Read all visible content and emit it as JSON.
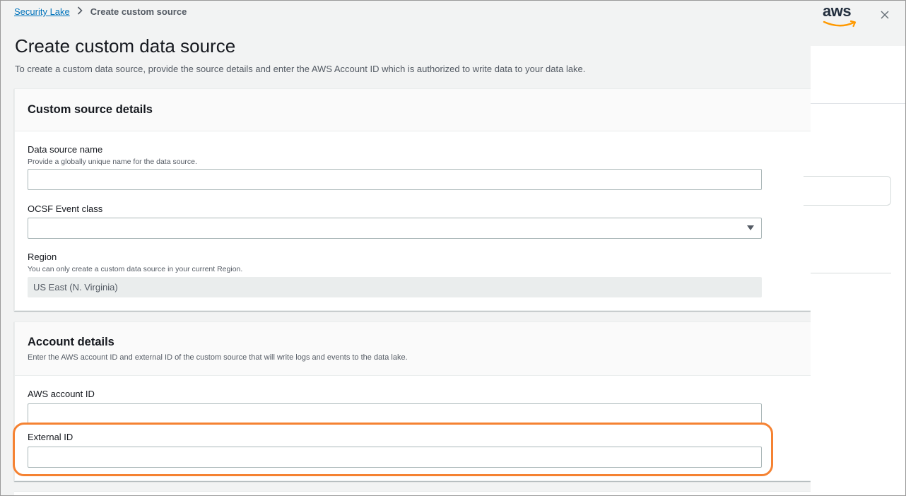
{
  "breadcrumb": {
    "root": "Security Lake",
    "current": "Create custom source"
  },
  "page": {
    "title": "Create custom data source",
    "description": "To create a custom data source, provide the source details and enter the AWS Account ID which is authorized to write data to your data lake."
  },
  "custom_source": {
    "heading": "Custom source details",
    "data_source_name_label": "Data source name",
    "data_source_name_hint": "Provide a globally unique name for the data source.",
    "data_source_name_value": "",
    "event_class_label": "OCSF Event class",
    "event_class_value": "",
    "region_label": "Region",
    "region_hint": "You can only create a custom data source in your current Region.",
    "region_value": "US East (N. Virginia)"
  },
  "account_details": {
    "heading": "Account details",
    "description": "Enter the AWS account ID and external ID of the custom source that will write logs and events to the data lake.",
    "account_id_label": "AWS account ID",
    "account_id_value": "",
    "external_id_label": "External ID",
    "external_id_value": ""
  },
  "side_panel": {
    "logo_text": "aws"
  },
  "colors": {
    "highlight": "#f58232",
    "link": "#0073bb",
    "aws_smile": "#ff9900"
  },
  "icons": {
    "close": "close-icon",
    "select": "caret-down-icon",
    "breadcrumb_separator": "chevron-right-icon"
  }
}
